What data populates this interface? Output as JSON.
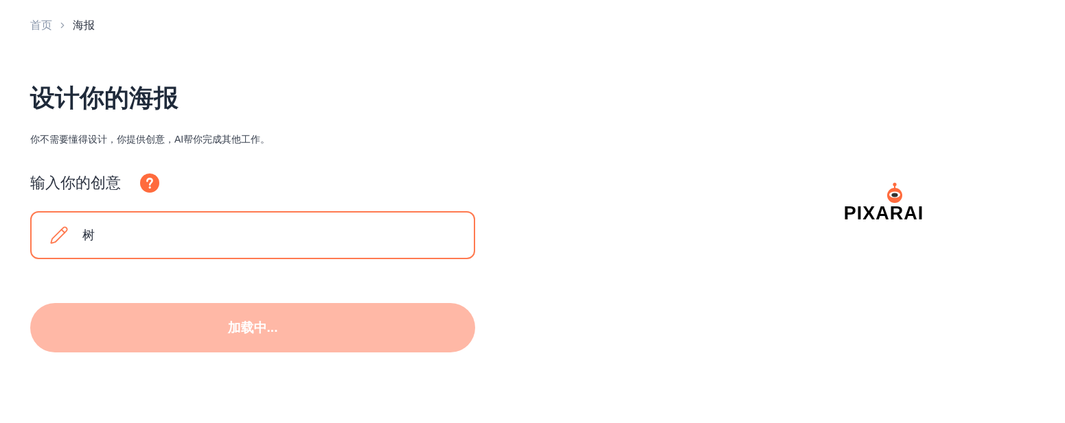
{
  "breadcrumb": [
    {
      "label": "首页",
      "current": false
    },
    {
      "label": "海报",
      "current": true
    }
  ],
  "title": "设计你的海报",
  "subtitle": "你不需要懂得设计，你提供创意，AI帮你完成其他工作。",
  "idea_field": {
    "label": "输入你的创意",
    "value": "树"
  },
  "generate_button": {
    "label": "加载中...",
    "disabled": true
  },
  "logo": {
    "text": "PIXARAI"
  }
}
